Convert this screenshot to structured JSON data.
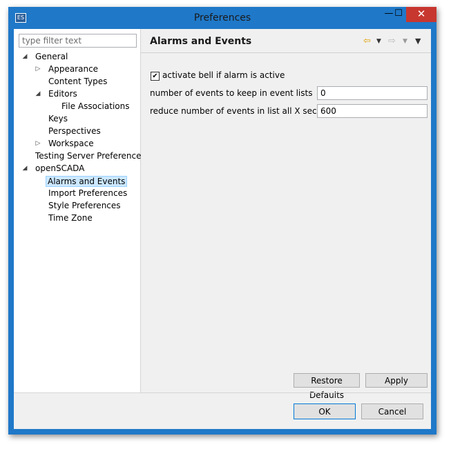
{
  "window": {
    "title": "Preferences",
    "minimize": "—",
    "maximize": "☐",
    "close": "✕",
    "app_icon": "ES"
  },
  "sidebar": {
    "filter_placeholder": "type filter text",
    "items": [
      {
        "label": "General",
        "level": 1,
        "twisty": "expanded"
      },
      {
        "label": "Appearance",
        "level": 2,
        "twisty": "collapsed"
      },
      {
        "label": "Content Types",
        "level": 2,
        "twisty": "none"
      },
      {
        "label": "Editors",
        "level": 2,
        "twisty": "expanded"
      },
      {
        "label": "File Associations",
        "level": 3,
        "twisty": "none"
      },
      {
        "label": "Keys",
        "level": 2,
        "twisty": "none"
      },
      {
        "label": "Perspectives",
        "level": 2,
        "twisty": "none"
      },
      {
        "label": "Workspace",
        "level": 2,
        "twisty": "collapsed"
      },
      {
        "label": "Testing Server Preferences",
        "level": 1,
        "twisty": "none"
      },
      {
        "label": "openSCADA",
        "level": 1,
        "twisty": "expanded"
      },
      {
        "label": "Alarms and Events",
        "level": 2,
        "twisty": "none",
        "selected": true
      },
      {
        "label": "Import Preferences",
        "level": 2,
        "twisty": "none"
      },
      {
        "label": "Style Preferences",
        "level": 2,
        "twisty": "none"
      },
      {
        "label": "Time Zone",
        "level": 2,
        "twisty": "none"
      }
    ]
  },
  "page": {
    "title": "Alarms and Events",
    "nav": {
      "back_icon": "back-arrow-icon",
      "forward_icon": "forward-arrow-icon",
      "menu_icon": "view-menu-icon"
    },
    "checkbox_label": "activate bell if alarm is active",
    "checkbox_checked": true,
    "events_label": "number of events to keep in event lists",
    "events_value": "0",
    "reduce_label": "reduce number of events in list all X seconds",
    "reduce_value": "600",
    "restore_defaults": "Restore Defaults",
    "apply": "Apply"
  },
  "footer": {
    "ok": "OK",
    "cancel": "Cancel"
  },
  "colors": {
    "titlebar": "#1f78c8",
    "close_button": "#c7372f",
    "selection": "#cce8ff",
    "nav_arrow": "#e0a000"
  }
}
